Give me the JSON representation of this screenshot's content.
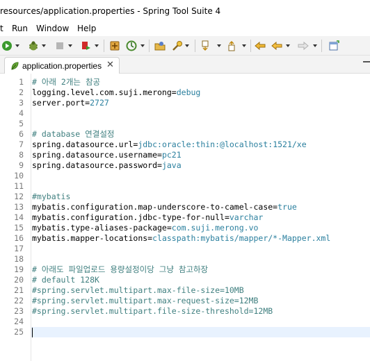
{
  "window": {
    "title": "resources/application.properties - Spring Tool Suite 4"
  },
  "menu": [
    "t",
    "Run",
    "Window",
    "Help"
  ],
  "toolbar": {
    "icons": [
      "run-icon",
      "debug-icon",
      "stop-icon",
      "coverage-icon",
      "new-spring-project-icon",
      "boot-dashboard-icon",
      "open-type-icon",
      "search-icon",
      "next-annotation-icon",
      "prev-annotation-icon",
      "last-edit-location-icon",
      "back-icon",
      "forward-icon",
      "open-perspective-icon"
    ]
  },
  "editor": {
    "tab_label": "application.properties",
    "lines": [
      {
        "n": "1",
        "parts": [
          [
            "c",
            "# 아래 2개는 참공"
          ]
        ]
      },
      {
        "n": "2",
        "parts": [
          [
            "k",
            "logging.level.com.suji.merong="
          ],
          [
            "v2",
            "debug"
          ]
        ]
      },
      {
        "n": "3",
        "parts": [
          [
            "k",
            "server.port="
          ],
          [
            "v2",
            "2727"
          ]
        ]
      },
      {
        "n": "4",
        "parts": []
      },
      {
        "n": "5",
        "parts": []
      },
      {
        "n": "6",
        "parts": [
          [
            "c",
            "# database 연결설정"
          ]
        ]
      },
      {
        "n": "7",
        "parts": [
          [
            "k",
            "spring.datasource.url="
          ],
          [
            "v2",
            "jdbc:oracle:thin:@localhost:1521/xe"
          ]
        ]
      },
      {
        "n": "8",
        "parts": [
          [
            "k",
            "spring.datasource.username="
          ],
          [
            "v2",
            "pc21"
          ]
        ]
      },
      {
        "n": "9",
        "parts": [
          [
            "k",
            "spring.datasource.password="
          ],
          [
            "v2",
            "java"
          ]
        ]
      },
      {
        "n": "10",
        "parts": []
      },
      {
        "n": "11",
        "parts": []
      },
      {
        "n": "12",
        "parts": [
          [
            "c",
            "#mybatis"
          ]
        ]
      },
      {
        "n": "13",
        "parts": [
          [
            "k",
            "mybatis.configuration.map-underscore-to-camel-case="
          ],
          [
            "v2",
            "true"
          ]
        ]
      },
      {
        "n": "14",
        "parts": [
          [
            "k",
            "mybatis.configuration.jdbc-type-for-null="
          ],
          [
            "v2",
            "varchar"
          ]
        ]
      },
      {
        "n": "15",
        "parts": [
          [
            "k",
            "mybatis.type-aliases-package="
          ],
          [
            "v2",
            "com.suji.merong.vo"
          ]
        ]
      },
      {
        "n": "16",
        "parts": [
          [
            "k",
            "mybatis.mapper-locations="
          ],
          [
            "v2",
            "classpath:mybatis/mapper/*-Mapper.xml"
          ]
        ]
      },
      {
        "n": "17",
        "parts": []
      },
      {
        "n": "18",
        "parts": []
      },
      {
        "n": "19",
        "parts": [
          [
            "c",
            "# 아래도 파일업로드 용량설정이당 그냥 참고하장"
          ]
        ]
      },
      {
        "n": "20",
        "parts": [
          [
            "c",
            "# default 128K"
          ]
        ]
      },
      {
        "n": "21",
        "parts": [
          [
            "c",
            "#spring.servlet.multipart.max-file-size=10MB"
          ]
        ]
      },
      {
        "n": "22",
        "parts": [
          [
            "c",
            "#spring.servlet.multipart.max-request-size=12MB"
          ]
        ]
      },
      {
        "n": "23",
        "parts": [
          [
            "c",
            "#spring.servlet.multipart.file-size-threshold=12MB"
          ]
        ]
      },
      {
        "n": "24",
        "parts": []
      },
      {
        "n": "25",
        "parts": []
      }
    ],
    "cursor_line": "25"
  }
}
